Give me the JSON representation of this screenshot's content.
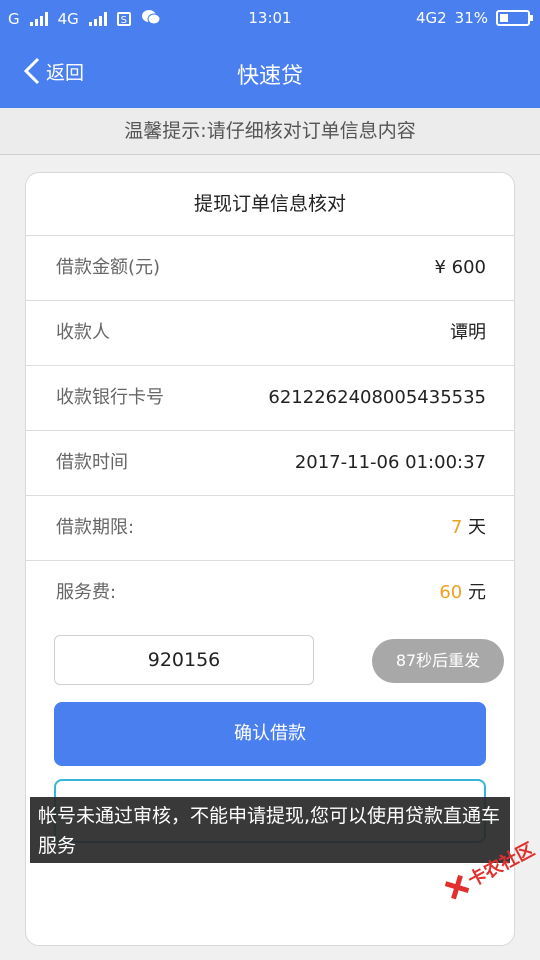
{
  "status": {
    "carrier1": "G",
    "carrier2": "4G",
    "sim_icon_text": "S",
    "time": "13:01",
    "network": "4G2",
    "battery_pct": "31%",
    "battery_level": 0.31
  },
  "nav": {
    "back_label": "返回",
    "title": "快速贷"
  },
  "tip": "温馨提示:请仔细核对订单信息内容",
  "card": {
    "title": "提现订单信息核对",
    "rows": [
      {
        "label": "借款金额(元)",
        "value": "¥ 600"
      },
      {
        "label": "收款人",
        "value": "谭明"
      },
      {
        "label": "收款银行卡号",
        "value": "6212262408005435535"
      },
      {
        "label": "借款时间",
        "value": "2017-11-06 01:00:37"
      },
      {
        "label": "借款期限:",
        "value": "7",
        "unit": "天"
      },
      {
        "label": "服务费:",
        "value": "60",
        "unit": "元"
      }
    ],
    "code_value": "920156",
    "resend_label": "87秒后重发",
    "confirm_label": "确认借款",
    "service_label": ""
  },
  "toast": "帐号未通过审核，不能申请提现,您可以使用贷款直通车服务",
  "watermark": "卡农社区",
  "colors": {
    "primary": "#4a7ff0",
    "accent": "#f0a020",
    "disabled": "#a8a8a8",
    "watermark": "#e0302e"
  }
}
